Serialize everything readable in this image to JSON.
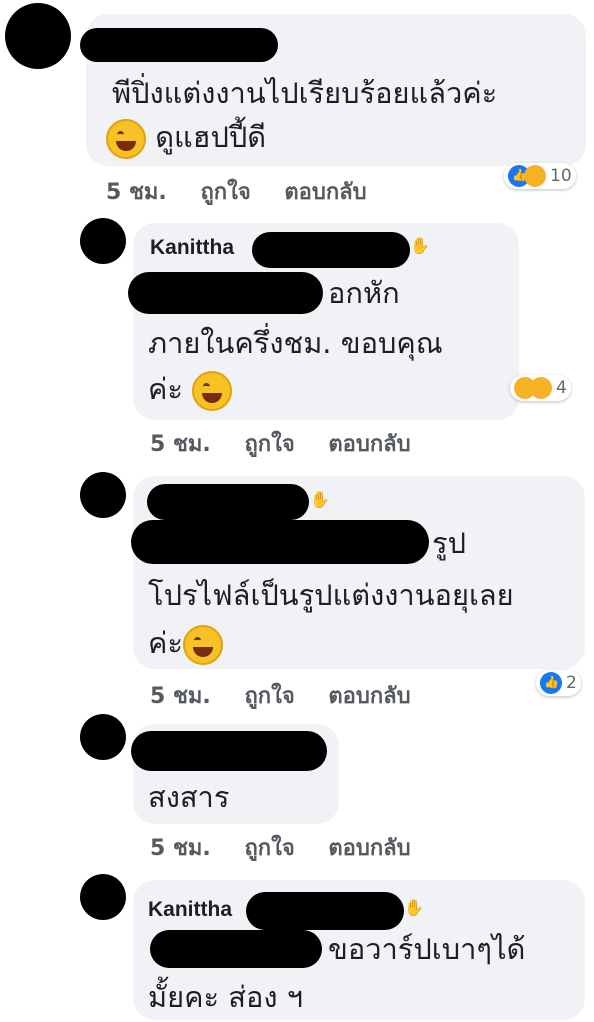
{
  "comments": [
    {
      "name": "",
      "lines": [
        "พีปิ่งแต่งงานไปเรียบร้อยแล้วค่ะ",
        "ดูแฮปปี้ดี"
      ],
      "time": "5 ชม.",
      "like": "ถูกใจ",
      "reply": "ตอบกลับ",
      "reaction_count": "10"
    },
    {
      "name": "Kanittha",
      "lines": [
        "อกหัก",
        "ภายในครึ่งชม. ขอบคุณ",
        "ค่ะ"
      ],
      "time": "5 ชม.",
      "like": "ถูกใจ",
      "reply": "ตอบกลับ",
      "reaction_count": "4"
    },
    {
      "name": "",
      "lines": [
        "รูป",
        "โปรไฟล์เป็นรูปแต่งงานอยุเลย",
        "ค่ะ"
      ],
      "time": "5 ชม.",
      "like": "ถูกใจ",
      "reply": "ตอบกลับ",
      "reaction_count": "2"
    },
    {
      "name": "",
      "lines": [
        "สงสาร"
      ],
      "time": "5 ชม.",
      "like": "ถูกใจ",
      "reply": "ตอบกลับ"
    },
    {
      "name": "Kanittha",
      "lines": [
        "ขอวาร์ปเบาๆได้",
        "มั้ยคะ ส่อง ฯ"
      ]
    }
  ],
  "colors": {
    "bubble": "#f0f2f5",
    "like_blue": "#1877f2",
    "haha_yellow": "#f7b125",
    "action_gray": "#555a61"
  },
  "icons": [
    "like-reaction-icon",
    "haha-reaction-icon",
    "sad-reaction-icon",
    "laughing-emoji-icon",
    "wave-icon"
  ]
}
